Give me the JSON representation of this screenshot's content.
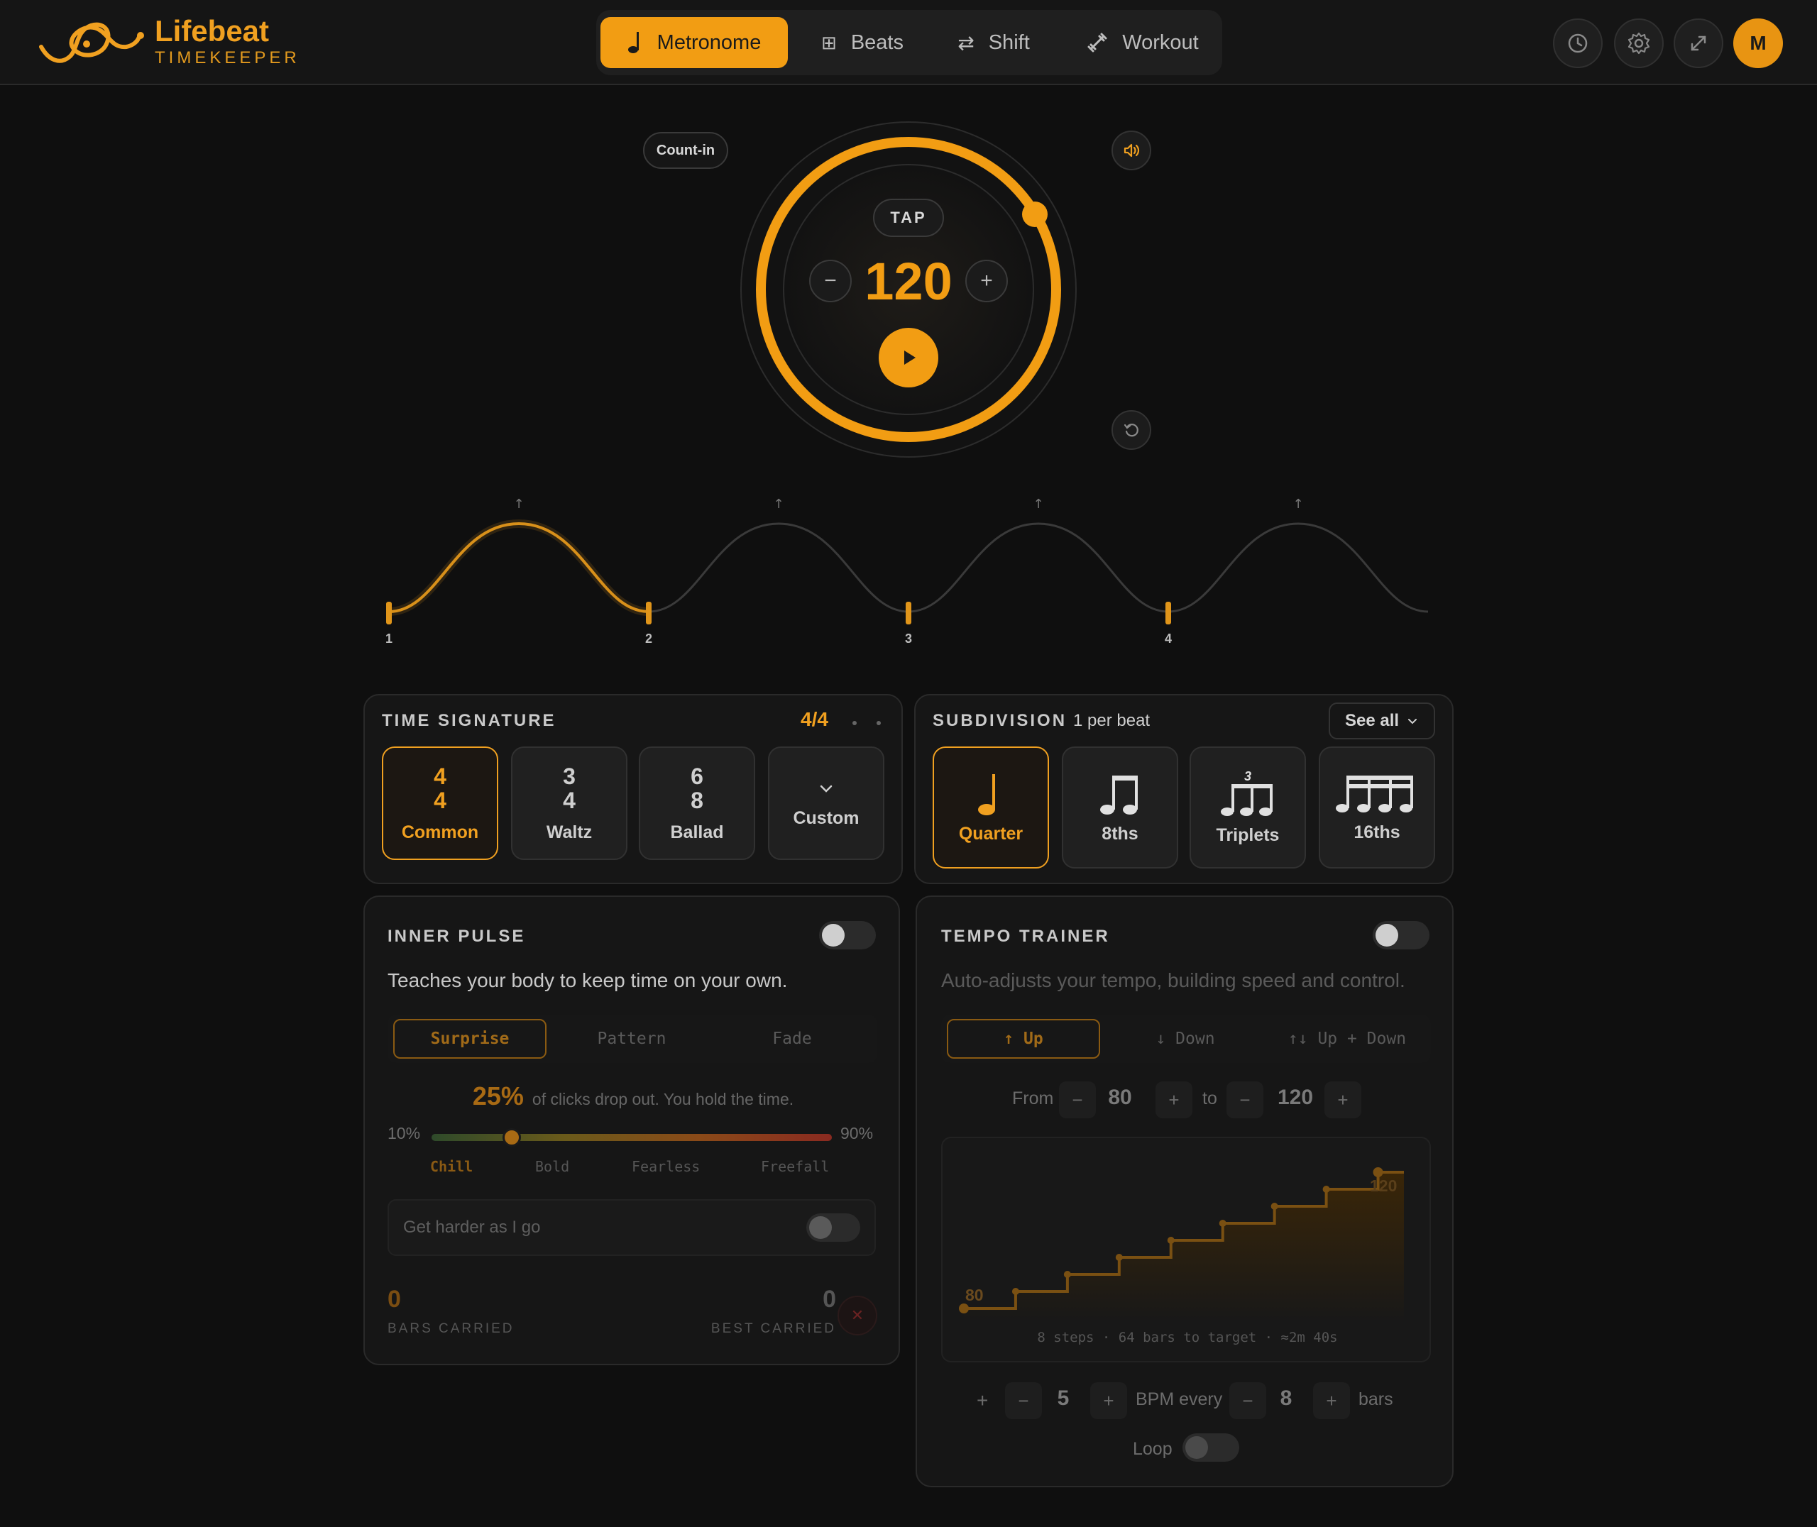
{
  "brand": {
    "title": "Lifebeat",
    "subtitle": "TIMEKEEPER",
    "accent": "#f29d13"
  },
  "nav": {
    "tabs": [
      {
        "label": "Metronome",
        "icon": "note-icon",
        "active": true
      },
      {
        "label": "Beats",
        "icon": "grid-icon",
        "active": false
      },
      {
        "label": "Shift",
        "icon": "arrows-icon",
        "active": false
      },
      {
        "label": "Workout",
        "icon": "dumbbell-icon",
        "active": false
      }
    ]
  },
  "header_actions": {
    "avatar_initial": "M",
    "icons": [
      "clock-icon",
      "gear-icon",
      "expand-icon"
    ]
  },
  "dial": {
    "count_in": "Count-in",
    "tap": "TAP",
    "bpm": "120",
    "minus": "−",
    "plus": "+"
  },
  "beats": {
    "labels": [
      "1",
      "2",
      "3",
      "4"
    ],
    "active_beat": 1
  },
  "time_signature": {
    "title": "TIME SIGNATURE",
    "current": "4/4",
    "options": [
      {
        "top": "4",
        "bottom": "4",
        "label": "Common",
        "selected": true
      },
      {
        "top": "3",
        "bottom": "4",
        "label": "Waltz",
        "selected": false
      },
      {
        "top": "6",
        "bottom": "8",
        "label": "Ballad",
        "selected": false
      },
      {
        "label": "Custom",
        "selected": false
      }
    ]
  },
  "subdivision": {
    "title": "SUBDIVISION",
    "detail": "1 per beat",
    "see_all": "See all",
    "options": [
      {
        "label": "Quarter",
        "selected": true
      },
      {
        "label": "8ths",
        "selected": false
      },
      {
        "label": "Triplets",
        "selected": false,
        "mark": "3"
      },
      {
        "label": "16ths",
        "selected": false
      }
    ]
  },
  "inner_pulse": {
    "title": "INNER PULSE",
    "description": "Teaches your body to keep time on your own.",
    "modes": [
      "Surprise",
      "Pattern",
      "Fade"
    ],
    "percent": "25%",
    "percent_text": "of clicks drop out. You hold the time.",
    "min": "10%",
    "max": "90%",
    "slider_value": 0.2,
    "levels": [
      "Chill",
      "Bold",
      "Fearless",
      "Freefall"
    ],
    "harder_label": "Get harder as I go",
    "bars_carried": "0",
    "bars_carried_label": "BARS CARRIED",
    "best_carried": "0",
    "best_carried_label": "BEST CARRIED"
  },
  "tempo_trainer": {
    "title": "TEMPO TRAINER",
    "description": "Auto-adjusts your tempo, building speed and control.",
    "modes": [
      "↑ Up",
      "↓ Down",
      "↑↓ Up + Down"
    ],
    "from_label": "From",
    "from_value": "80",
    "to_label": "to",
    "to_value": "120",
    "chart_start": "80",
    "chart_end": "120",
    "summary": "8 steps · 64 bars to target · ≈2m 40s",
    "increment_sign": "+",
    "increment": "5",
    "every_label": "BPM every",
    "every_value": "8",
    "bars_label": "bars",
    "loop_label": "Loop",
    "steps": [
      80,
      85,
      90,
      95,
      100,
      105,
      110,
      115,
      120
    ]
  }
}
